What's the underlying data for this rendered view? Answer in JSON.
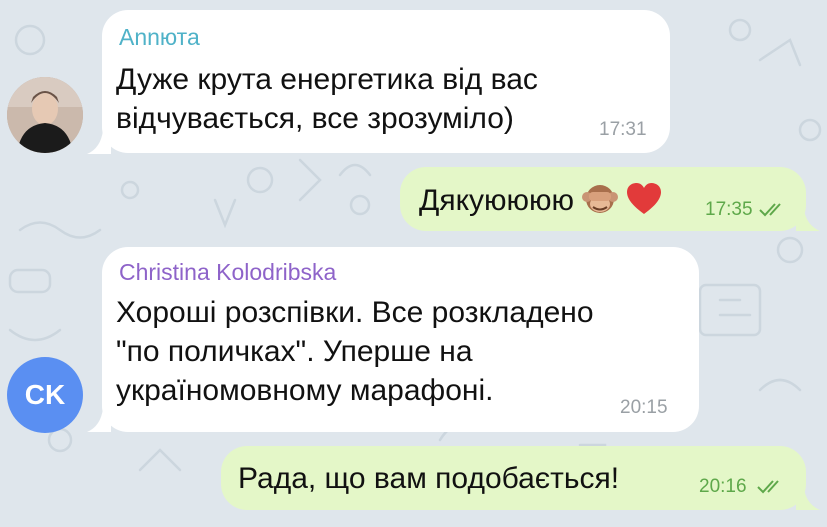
{
  "chat": {
    "messages": [
      {
        "sender": "Аnnюта",
        "text": "Дуже крута енергетика від вас\nвідчувається, все зрозуміло)",
        "time": "17:31"
      },
      {
        "text": "Дякуюююю",
        "emoji": [
          "see-no-evil-monkey-emoji",
          "red-heart-emoji"
        ],
        "time": "17:35"
      },
      {
        "sender": "Christina Kolodribska",
        "text": "Хороші розспівки. Все розкладено\n\"по поличках\". Уперше на\nукраїномовному марафоні.",
        "time": "20:15"
      },
      {
        "text": "Рада, що вам подобається!",
        "time": "20:16"
      }
    ],
    "avatars": {
      "christina_initials": "CK"
    }
  },
  "colors": {
    "background": "#dfe6ec",
    "incoming_bubble": "#ffffff",
    "outgoing_bubble": "#e4f7c8",
    "sender_1_name": "#4fb2c8",
    "sender_2_name": "#8e63c9",
    "outgoing_time": "#5ea84a",
    "avatar_ck": "#5a8ff2"
  }
}
